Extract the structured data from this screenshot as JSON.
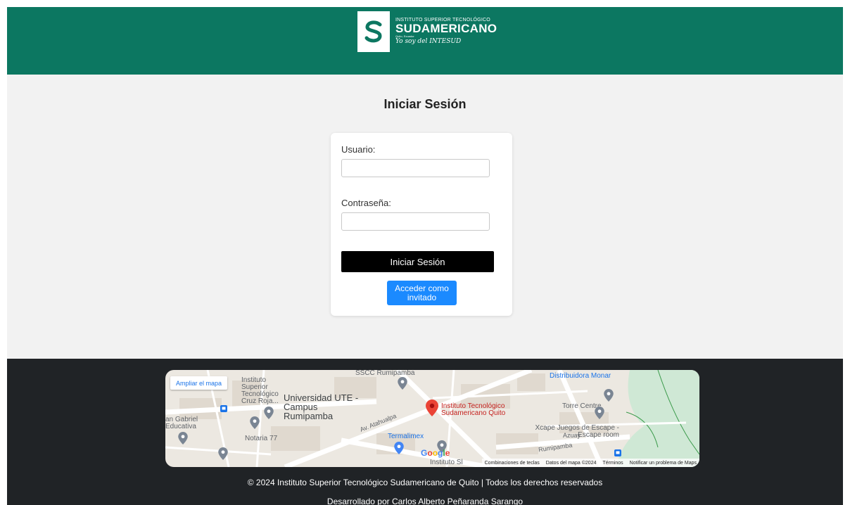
{
  "header": {
    "logo": {
      "line1": "INSTITUTO SUPERIOR TECNOLÓGICO",
      "line2": "SUDAMERICANO",
      "line3": "Quito, Ecuador",
      "slogan": "Yo soy del INTESUD"
    },
    "brand_color": "#0c7761"
  },
  "login": {
    "title": "Iniciar Sesión",
    "username_label": "Usuario:",
    "username_value": "",
    "password_label": "Contraseña:",
    "password_value": "",
    "submit_label": "Iniciar Sesión",
    "guest_label": "Acceder como invitado"
  },
  "map": {
    "expand_label": "Ampliar el mapa",
    "places": {
      "p1": "Instituto Superior Tecnológico Cruz Roja...",
      "p2": "Universidad UTE - Campus Rumipamba",
      "p3": "SSCC Rumipamba",
      "p4": "Av. Atahualpa",
      "p5": "Instituto Tecnológico Sudamericano Quito",
      "p6": "Distribuidora Monar",
      "p7": "Torre Centre",
      "p8": "Azuay",
      "p9": "Xcape Juegos de Escape - Escape room",
      "p10": "Rumipamba",
      "p11": "Termalimex",
      "p12": "Notaria 77",
      "p13": "an Gabriel Educativa",
      "p14": "Instituto Sl"
    },
    "attribution": {
      "shortcuts": "Combinaciones de teclas",
      "data": "Datos del mapa ©2024",
      "terms": "Términos",
      "report": "Notificar un problema de Maps"
    }
  },
  "footer": {
    "copyright": "© 2024 Instituto Superior Tecnológico Sudamericano de Quito | Todos los derechos reservados",
    "developer": "Desarrollado por Carlos Alberto Peñaranda Sarango"
  }
}
